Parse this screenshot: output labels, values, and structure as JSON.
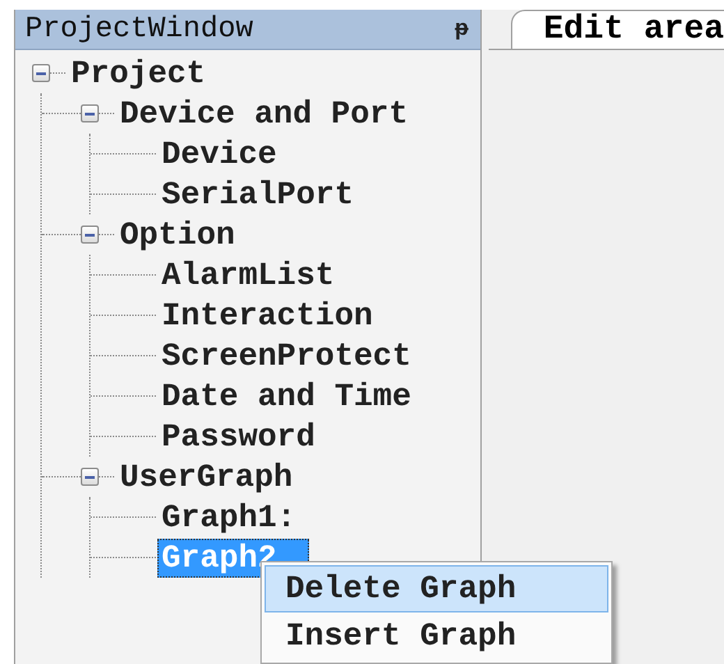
{
  "project_window": {
    "title": "ProjectWindow",
    "pin": "ᵽ"
  },
  "tree": [
    {
      "label": "Project",
      "expanded": true,
      "selected": false,
      "children": [
        {
          "label": "Device and Port",
          "expanded": true,
          "selected": false,
          "children": [
            {
              "label": "Device",
              "selected": false
            },
            {
              "label": "SerialPort",
              "selected": false
            }
          ]
        },
        {
          "label": "Option",
          "expanded": true,
          "selected": false,
          "children": [
            {
              "label": "AlarmList",
              "selected": false
            },
            {
              "label": "Interaction",
              "selected": false
            },
            {
              "label": "ScreenProtect",
              "selected": false
            },
            {
              "label": "Date and Time",
              "selected": false
            },
            {
              "label": "Password",
              "selected": false
            }
          ]
        },
        {
          "label": "UserGraph",
          "expanded": true,
          "selected": false,
          "children": [
            {
              "label": "Graph1:",
              "selected": false
            },
            {
              "label": "Graph2",
              "selected": true
            }
          ]
        }
      ]
    }
  ],
  "edit_tab": {
    "label": "Edit area",
    "selected": true
  },
  "context_menu": [
    {
      "label": "Delete Graph",
      "selected": true
    },
    {
      "label": "Insert Graph",
      "selected": false
    }
  ]
}
